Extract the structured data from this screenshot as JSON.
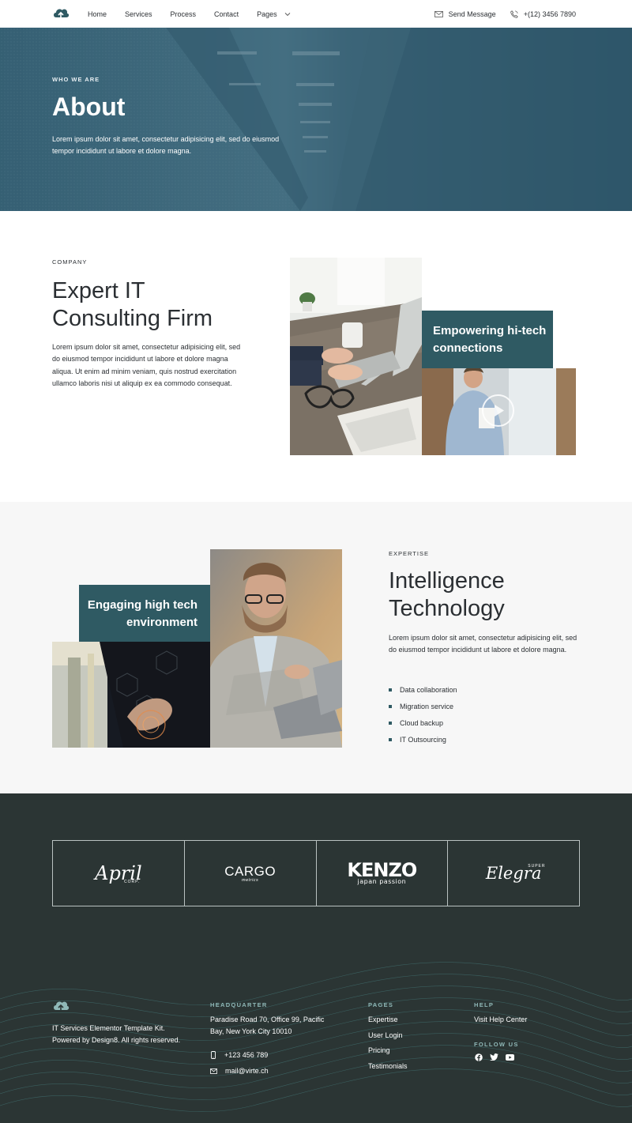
{
  "nav": {
    "links": [
      "Home",
      "Services",
      "Process",
      "Contact",
      "Pages"
    ],
    "send_message": "Send Message",
    "phone": "+(12) 3456 7890"
  },
  "hero": {
    "kicker": "WHO WE ARE",
    "title": "About",
    "description": "Lorem ipsum dolor sit amet, consectetur adipisicing elit, sed do eiusmod tempor incididunt ut labore et dolore magna."
  },
  "company": {
    "kicker": "COMPANY",
    "title": "Expert IT Consulting Firm",
    "description": "Lorem ipsum dolor sit amet, consectetur adipisicing elit, sed do eiusmod tempor incididunt ut labore et dolore magna aliqua. Ut enim ad minim veniam, quis nostrud exercitation ullamco laboris nisi ut aliquip ex ea commodo consequat.",
    "card_text": "Empowering hi-tech connections"
  },
  "expertise": {
    "kicker": "EXPERTISE",
    "title": "Intelligence Technology",
    "description": "Lorem ipsum dolor sit amet, consectetur adipisicing elit, sed do eiusmod tempor incididunt ut labore et dolore magna.",
    "card_text": "Engaging high tech environment",
    "list": [
      "Data collaboration",
      "Migration service",
      "Cloud backup",
      "IT Outsourcing"
    ]
  },
  "brands": {
    "april": "April",
    "april_sub": "CORP.",
    "cargo": "CARGO",
    "cargo_sub": "metrics",
    "kenzo": "KENZO",
    "kenzo_sub": "japan passion",
    "elegra": "Elegra",
    "elegra_sub": "SUPER"
  },
  "footer": {
    "copyright": "IT Services Elementor Template Kit. Powered by Design8. All rights reserved.",
    "hq_heading": "HEADQUARTER",
    "address": "Paradise Road 70, Office 99, Pacific Bay,  New York City 10010",
    "phone": "+123 456 789",
    "email": "mail@virte.ch",
    "pages_heading": "PAGES",
    "pages": [
      "Expertise",
      "User Login",
      "Pricing",
      "Testimonials"
    ],
    "help_heading": "HELP",
    "help_link": "Visit Help Center",
    "follow_heading": "FOLLOW US"
  },
  "colors": {
    "teal": "#2f5a63",
    "footer_bg": "#2b3534",
    "heading_accent": "#8fb8b7"
  },
  "icons": [
    "cloud-upload-icon",
    "chevron-down-icon",
    "envelope-icon",
    "phone-icon",
    "play-icon",
    "mobile-icon",
    "facebook-icon",
    "twitter-icon",
    "youtube-icon"
  ]
}
